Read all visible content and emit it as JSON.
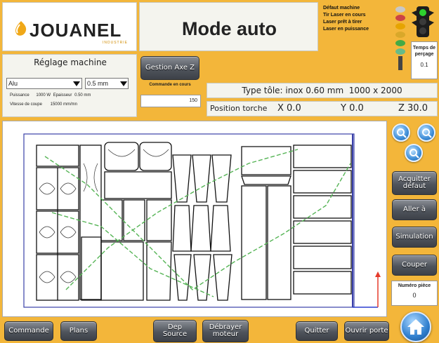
{
  "brand": {
    "name": "JOUANEL",
    "sub": "INDUSTRIE"
  },
  "header": {
    "title": "Mode auto"
  },
  "status": {
    "items": [
      "Défaut machine",
      "Tir Laser en cours",
      "Laser prêt à tirer",
      "Laser en puissance"
    ],
    "perc_label": "Temps de perçage",
    "perc_value": "0.1"
  },
  "settings": {
    "title": "Réglage machine",
    "material": "Alu",
    "thickness": "0.5 mm",
    "power_label": "Puissance",
    "power_value": "1000 W",
    "ep_label": "Epaisseur",
    "ep_value": "0.50 mm",
    "speed_label": "Vitesse de coupe",
    "speed_value": "15000 mm/mn"
  },
  "gestion": {
    "label": "Gestion Axe Z"
  },
  "command": {
    "label": "Commande en cours",
    "value": "150"
  },
  "sheet": {
    "label": "Type tôle: inox 0.60 mm  1000 x 2000"
  },
  "position": {
    "label": "Position torche",
    "x": "X 0.0",
    "y": "Y 0.0",
    "z": "Z 30.0"
  },
  "side": {
    "acquit": "Acquitter défaut",
    "aller": "Aller à",
    "simulation": "Simulation",
    "couper": "Couper",
    "piece_label": "Numéro pièce",
    "piece_value": "0"
  },
  "bottom": {
    "commande": "Commande",
    "plans": "Plans",
    "dep_source": "Dep Source",
    "debrayer": "Débrayer moteur",
    "quitter": "Quitter",
    "ouvrir": "Ouvrir porte"
  },
  "colors": {
    "accent": "#f3b63a",
    "button": "#4f545c",
    "frame": "#3a40a8",
    "path": "#55b455"
  }
}
